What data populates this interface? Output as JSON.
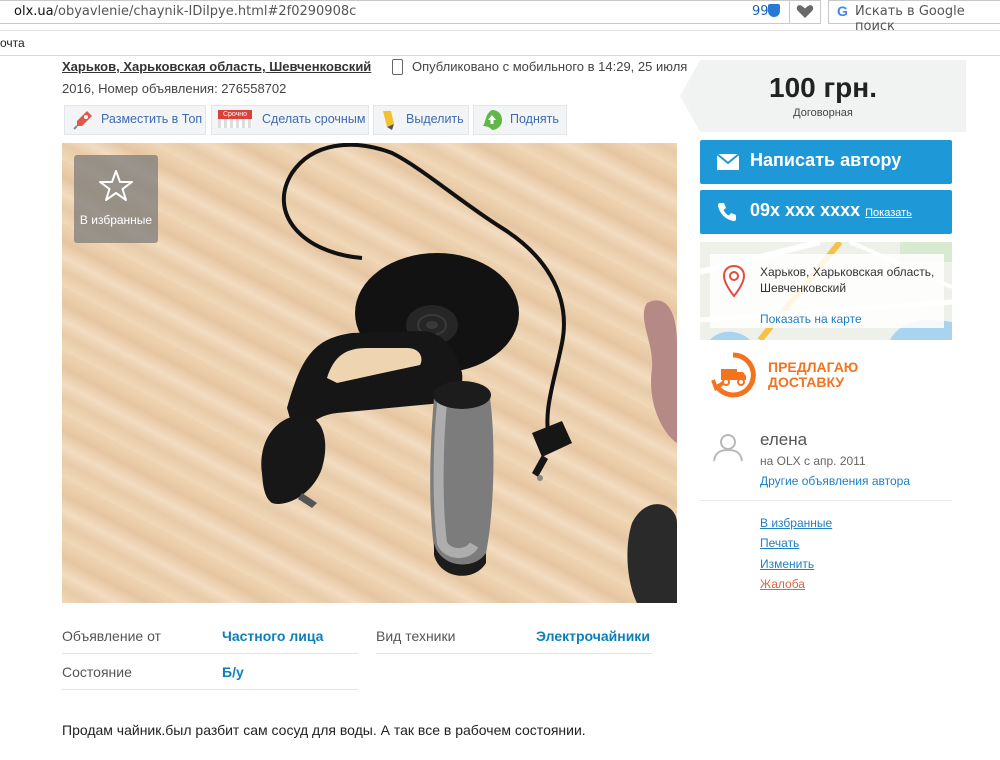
{
  "browser": {
    "url_host": "olx.ua",
    "url_path": "/obyavlenie/chaynik-IDiIpye.html#2f0290908c",
    "counter": "99",
    "search_placeholder": "Искать в Google поиск",
    "bookmark": "очта"
  },
  "ad": {
    "location": "Харьков, Харьковская область, Шевченковский",
    "published": "Опубликовано с мобильного в 14:29, 25 июля",
    "meta_line": "2016, Номер объявления: 276558702"
  },
  "actions": [
    {
      "label": "Разместить в Топ",
      "icon": "rocket-icon"
    },
    {
      "label": "Сделать срочным",
      "icon": "urgent-stamp-icon",
      "stamp": "Срочно"
    },
    {
      "label": "Выделить",
      "icon": "highlighter-icon"
    },
    {
      "label": "Поднять",
      "icon": "up-arrow-icon"
    }
  ],
  "photo": {
    "favorite_label": "В избранные",
    "favorite_icon": "star-icon"
  },
  "details": {
    "offer_from_label": "Объявление от",
    "offer_from_value": "Частного лица",
    "tech_type_label": "Вид техники",
    "tech_type_value": "Электрочайники",
    "condition_label": "Состояние",
    "condition_value": "Б/у"
  },
  "description": "Продам чайник.был разбит сам сосуд для воды. А так все в рабочем состоянии.",
  "price": {
    "value": "100 грн.",
    "note": "Договорная"
  },
  "contact": {
    "write_label": "Написать автору",
    "phone": "09x xxx xxxx",
    "show_label": "Показать"
  },
  "map": {
    "address": "Харьков, Харьковская область, Шевченковский",
    "show_map": "Показать на карте"
  },
  "delivery": {
    "line1": "ПРЕДЛАГАЮ",
    "line2": "ДОСТАВКУ"
  },
  "seller": {
    "name": "елена",
    "since": "на OLX с апр. 2011",
    "other_ads": "Другие объявления автора"
  },
  "side_links": {
    "favorites": "В избранные",
    "print": "Печать",
    "edit": "Изменить",
    "complaint": "Жалоба"
  },
  "colors": {
    "accent_blue": "#1e98d6",
    "link_blue": "#1e7fc1",
    "detail_value": "#0d7fb8",
    "delivery_orange": "#f4731f",
    "complaint_red": "#d0694a"
  }
}
